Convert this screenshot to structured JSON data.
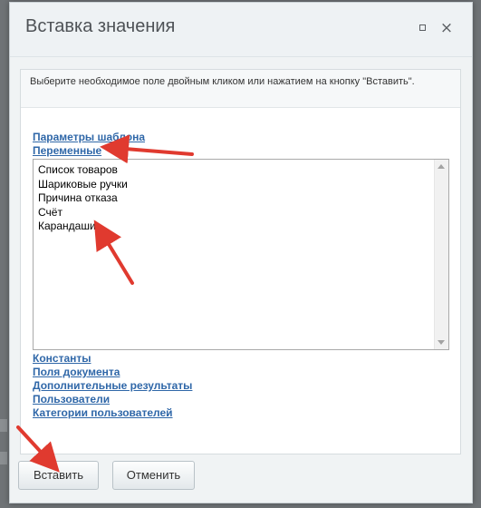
{
  "dialog": {
    "title": "Вставка значения",
    "maximize_icon": "maximize-icon",
    "close_icon": "×"
  },
  "hint": "Выберите необходимое поле двойным кликом или нажатием на кнопку \"Вставить\".",
  "groups_top": [
    "Параметры шаблона",
    "Переменные"
  ],
  "variables": [
    "Список товаров",
    "Шариковые ручки",
    "Причина отказа",
    "Счёт",
    "Карандаши"
  ],
  "groups_bottom": [
    "Константы",
    "Поля документа",
    "Дополнительные результаты",
    "Пользователи",
    "Категории пользователей"
  ],
  "buttons": {
    "insert": "Вставить",
    "cancel": "Отменить"
  },
  "colors": {
    "link": "#2f67a8",
    "annotation_arrow": "#e03a2f"
  }
}
